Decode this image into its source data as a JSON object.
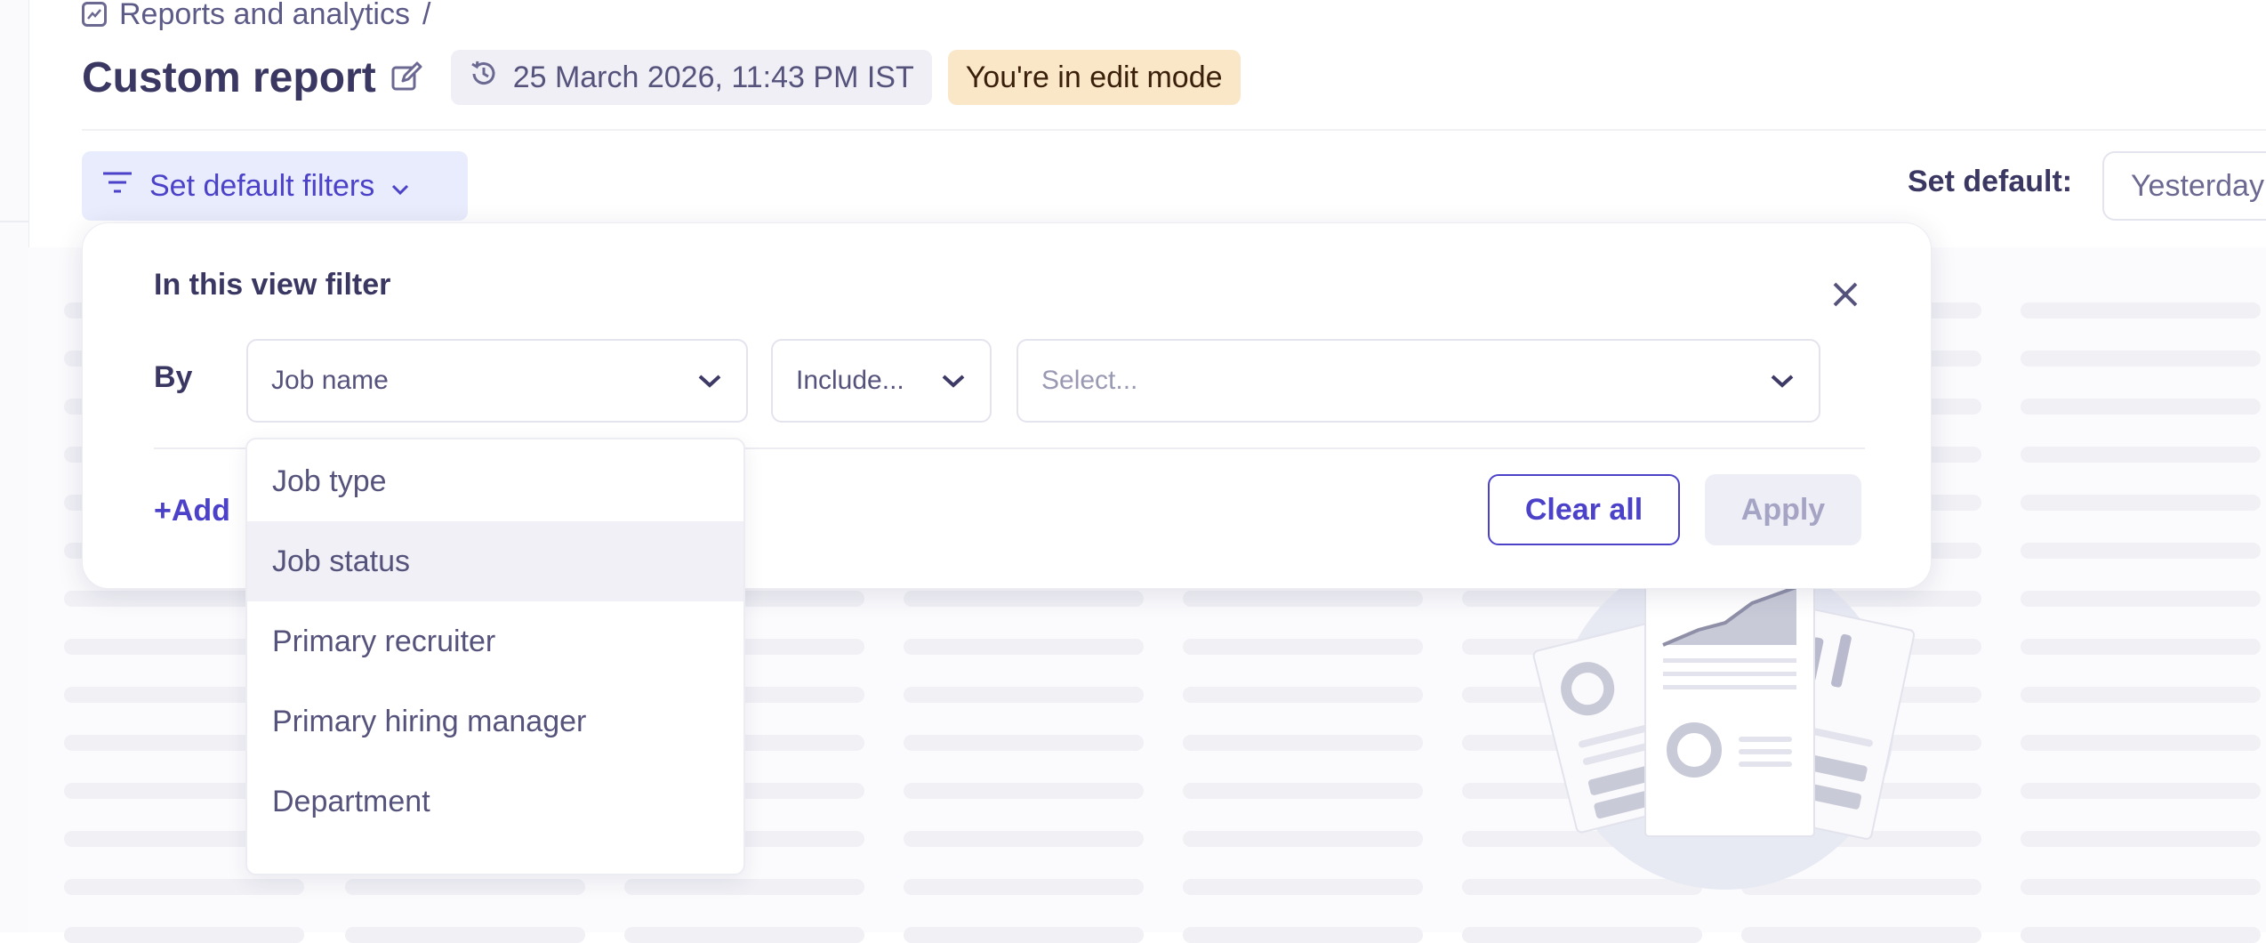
{
  "breadcrumb": {
    "section": "Reports and analytics",
    "separator": "/"
  },
  "header": {
    "title": "Custom report",
    "timestamp": "25 March 2026, 11:43 PM IST",
    "mode_badge": "You're in edit mode"
  },
  "toolbar": {
    "filter_button_label": "Set default filters",
    "set_default_label": "Set default:",
    "date_range_value": "Yesterday"
  },
  "filter_panel": {
    "heading": "In this view filter",
    "by_label": "By",
    "field_select_value": "Job name",
    "operator_select_value": "Include...",
    "value_placeholder": "Select...",
    "add_link": "+Add",
    "clear_all_label": "Clear all",
    "apply_label": "Apply"
  },
  "field_dropdown": {
    "options": [
      "Job type",
      "Job status",
      "Primary recruiter",
      "Primary hiring manager",
      "Department"
    ],
    "highlighted": "Job status"
  },
  "colors": {
    "accent": "#4b42c9",
    "badge_bg": "#fae7c8",
    "chip_bg": "#efeff5",
    "filter_button_bg": "#e9ecfc"
  }
}
